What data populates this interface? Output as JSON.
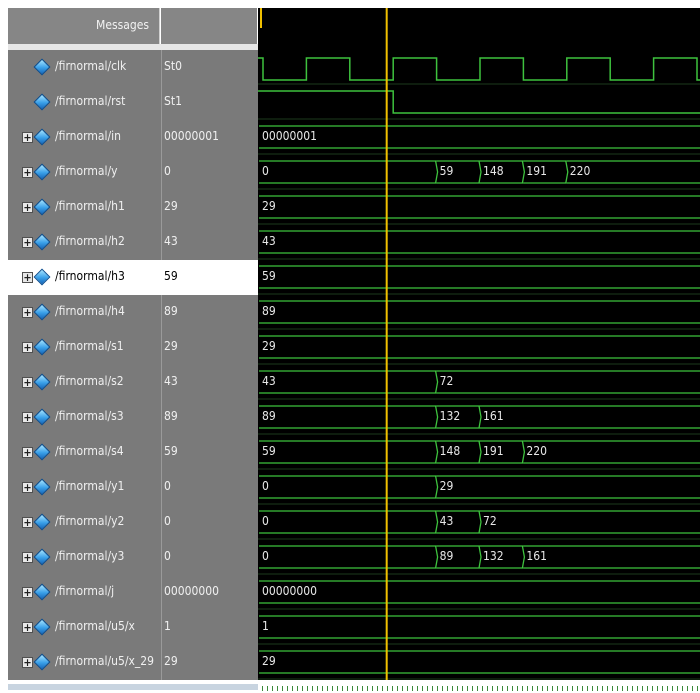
{
  "header": {
    "messages_label": "Messages"
  },
  "selected_index": 6,
  "signals": [
    {
      "name": "/firnormal/clk",
      "value": "St0",
      "kind": "clock",
      "expandable": false
    },
    {
      "name": "/firnormal/rst",
      "value": "St1",
      "kind": "reset",
      "expandable": false
    },
    {
      "name": "/firnormal/in",
      "value": "00000001",
      "kind": "bus",
      "expandable": true,
      "segments": [
        {
          "t": 0,
          "v": "00000001"
        }
      ]
    },
    {
      "name": "/firnormal/y",
      "value": "0",
      "kind": "bus",
      "expandable": true,
      "segments": [
        {
          "t": 0,
          "v": "0"
        },
        {
          "t": 4,
          "v": "59"
        },
        {
          "t": 5,
          "v": "148"
        },
        {
          "t": 6,
          "v": "191"
        },
        {
          "t": 7,
          "v": "220"
        }
      ]
    },
    {
      "name": "/firnormal/h1",
      "value": "29",
      "kind": "bus",
      "expandable": true,
      "segments": [
        {
          "t": 0,
          "v": "29"
        }
      ]
    },
    {
      "name": "/firnormal/h2",
      "value": "43",
      "kind": "bus",
      "expandable": true,
      "segments": [
        {
          "t": 0,
          "v": "43"
        }
      ]
    },
    {
      "name": "/firnormal/h3",
      "value": "59",
      "kind": "bus",
      "expandable": true,
      "segments": [
        {
          "t": 0,
          "v": "59"
        }
      ]
    },
    {
      "name": "/firnormal/h4",
      "value": "89",
      "kind": "bus",
      "expandable": true,
      "segments": [
        {
          "t": 0,
          "v": "89"
        }
      ]
    },
    {
      "name": "/firnormal/s1",
      "value": "29",
      "kind": "bus",
      "expandable": true,
      "segments": [
        {
          "t": 0,
          "v": "29"
        }
      ]
    },
    {
      "name": "/firnormal/s2",
      "value": "43",
      "kind": "bus",
      "expandable": true,
      "segments": [
        {
          "t": 0,
          "v": "43"
        },
        {
          "t": 4,
          "v": "72"
        }
      ]
    },
    {
      "name": "/firnormal/s3",
      "value": "89",
      "kind": "bus",
      "expandable": true,
      "segments": [
        {
          "t": 0,
          "v": "89"
        },
        {
          "t": 4,
          "v": "132"
        },
        {
          "t": 5,
          "v": "161"
        }
      ]
    },
    {
      "name": "/firnormal/s4",
      "value": "59",
      "kind": "bus",
      "expandable": true,
      "segments": [
        {
          "t": 0,
          "v": "59"
        },
        {
          "t": 4,
          "v": "148"
        },
        {
          "t": 5,
          "v": "191"
        },
        {
          "t": 6,
          "v": "220"
        }
      ]
    },
    {
      "name": "/firnormal/y1",
      "value": "0",
      "kind": "bus",
      "expandable": true,
      "segments": [
        {
          "t": 0,
          "v": "0"
        },
        {
          "t": 4,
          "v": "29"
        }
      ]
    },
    {
      "name": "/firnormal/y2",
      "value": "0",
      "kind": "bus",
      "expandable": true,
      "segments": [
        {
          "t": 0,
          "v": "0"
        },
        {
          "t": 4,
          "v": "43"
        },
        {
          "t": 5,
          "v": "72"
        }
      ]
    },
    {
      "name": "/firnormal/y3",
      "value": "0",
      "kind": "bus",
      "expandable": true,
      "segments": [
        {
          "t": 0,
          "v": "0"
        },
        {
          "t": 4,
          "v": "89"
        },
        {
          "t": 5,
          "v": "132"
        },
        {
          "t": 6,
          "v": "161"
        }
      ]
    },
    {
      "name": "/firnormal/j",
      "value": "00000000",
      "kind": "bus",
      "expandable": true,
      "segments": [
        {
          "t": 0,
          "v": "00000000"
        }
      ]
    },
    {
      "name": "/firnormal/u5/x",
      "value": "1",
      "kind": "bus",
      "expandable": true,
      "segments": [
        {
          "t": 0,
          "v": "1"
        }
      ]
    },
    {
      "name": "/firnormal/u5/x_29",
      "value": "29",
      "kind": "bus",
      "expandable": true,
      "segments": [
        {
          "t": 0,
          "v": "29"
        }
      ]
    }
  ],
  "cursor": {
    "t": 2.85,
    "color": "#f0c000"
  },
  "colors": {
    "wave": "#3ec23e",
    "background": "#000000",
    "cursor": "#f0c000",
    "grid": "#2a6a2a"
  }
}
